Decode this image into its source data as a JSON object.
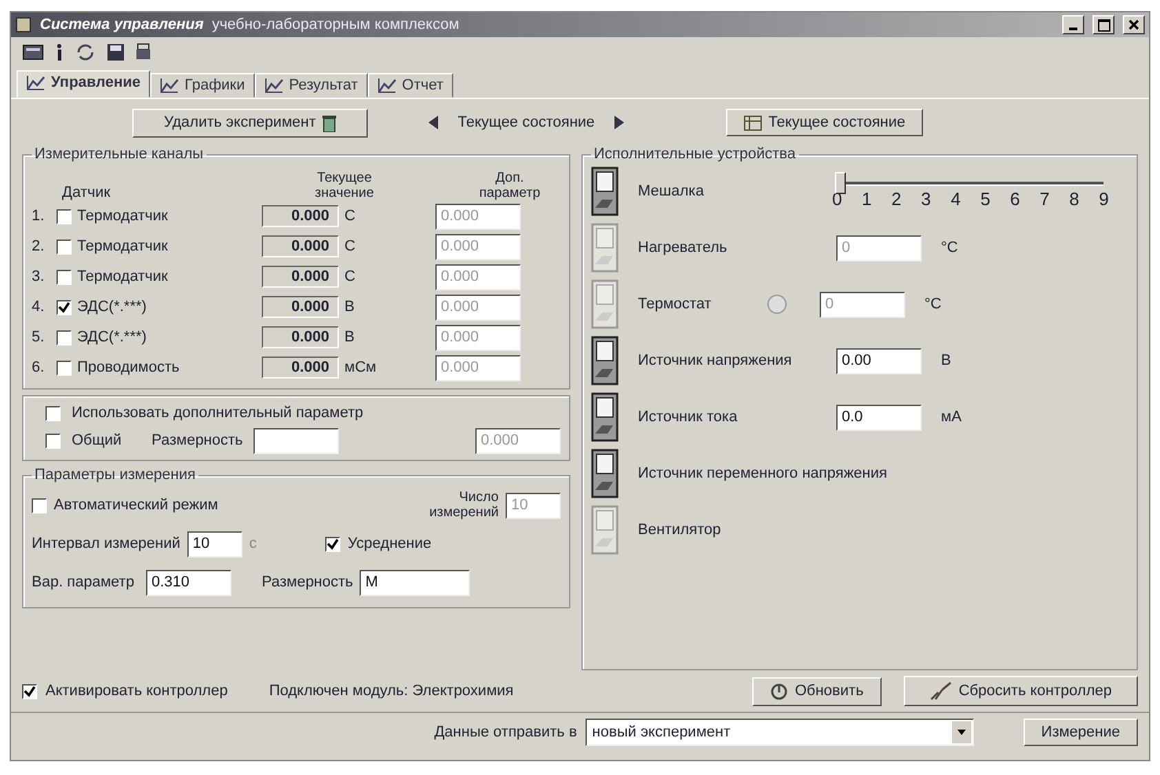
{
  "window": {
    "title": "Система управления",
    "subtitle": "учебно-лабораторным комплексом"
  },
  "tabs": [
    {
      "label": "Управление",
      "selected": true
    },
    {
      "label": "Графики",
      "selected": false
    },
    {
      "label": "Результат",
      "selected": false
    },
    {
      "label": "Отчет",
      "selected": false
    }
  ],
  "top_bar": {
    "delete_button": "Удалить эксперимент",
    "nav_label": "Текущее состояние",
    "state_button": "Текущее состояние"
  },
  "channels": {
    "title": "Измерительные каналы",
    "col_sensor": "Датчик",
    "col_value": "Текущее значение",
    "col_param": "Доп. параметр",
    "rows": [
      {
        "num": "1.",
        "checked": false,
        "name": "Термодатчик",
        "value": "0.000",
        "unit": "С",
        "param": "0.000"
      },
      {
        "num": "2.",
        "checked": false,
        "name": "Термодатчик",
        "value": "0.000",
        "unit": "С",
        "param": "0.000"
      },
      {
        "num": "3.",
        "checked": false,
        "name": "Термодатчик",
        "value": "0.000",
        "unit": "С",
        "param": "0.000"
      },
      {
        "num": "4.",
        "checked": true,
        "name": "ЭДС(*.***)",
        "value": "0.000",
        "unit": "В",
        "param": "0.000"
      },
      {
        "num": "5.",
        "checked": false,
        "name": "ЭДС(*.***)",
        "value": "0.000",
        "unit": "В",
        "param": "0.000"
      },
      {
        "num": "6.",
        "checked": false,
        "name": "Проводимость",
        "value": "0.000",
        "unit": "мСм",
        "param": "0.000"
      }
    ]
  },
  "extra": {
    "use_label": "Использовать дополнительный параметр",
    "use_checked": false,
    "common_label": "Общий",
    "common_checked": false,
    "dim_label": "Размерность",
    "param_value": "0.000"
  },
  "measure": {
    "title": "Параметры измерения",
    "auto_label": "Автоматический режим",
    "auto_checked": false,
    "count_label": "Число измерений",
    "count_value": "10",
    "interval_label": "Интервал измерений",
    "interval_value": "10",
    "interval_unit": "с",
    "avg_label": "Усреднение",
    "avg_checked": true,
    "var_label": "Вар. параметр",
    "var_value": "0.310",
    "dim_label": "Размерность",
    "dim_value": "М"
  },
  "devices": {
    "title": "Исполнительные устройства",
    "items": [
      {
        "kind": "slider",
        "name": "Мешалка",
        "on": true,
        "level": 0,
        "ticks": [
          "0",
          "1",
          "2",
          "3",
          "4",
          "5",
          "6",
          "7",
          "8",
          "9"
        ]
      },
      {
        "kind": "field",
        "name": "Нагреватель",
        "on": false,
        "value": "0",
        "unit": "°С",
        "disabled": true
      },
      {
        "kind": "lamp_field",
        "name": "Термостат",
        "on": false,
        "lamp": false,
        "value": "0",
        "unit": "°С",
        "disabled": true
      },
      {
        "kind": "field",
        "name": "Источник напряжения",
        "on": true,
        "value": "0.00",
        "unit": "В",
        "disabled": false
      },
      {
        "kind": "field",
        "name": "Источник тока",
        "on": true,
        "value": "0.0",
        "unit": "мА",
        "disabled": false
      },
      {
        "kind": "plain",
        "name": "Источник переменного напряжения",
        "on": true
      },
      {
        "kind": "plain",
        "name": "Вентилятор",
        "on": false
      }
    ]
  },
  "bottom": {
    "activate_label": "Активировать контроллер",
    "activate_checked": true,
    "module_text": "Подключен модуль: Электрохимия",
    "refresh_button": "Обновить",
    "reset_button": "Сбросить контроллер"
  },
  "footer": {
    "send_label": "Данные отправить в",
    "send_value": "новый эксперимент",
    "measure_button": "Измерение"
  }
}
